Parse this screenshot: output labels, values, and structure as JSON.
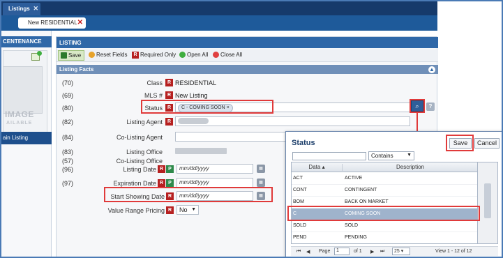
{
  "topbar": {
    "tab": "Listings"
  },
  "subbar": {
    "tab": "New RESIDENTIAL"
  },
  "sidebar": {
    "header": "CENTENANCE",
    "photo_text_1": "IMAGE",
    "photo_text_2": "AILABLE",
    "link": "ain Listing"
  },
  "main": {
    "header": "LISTING",
    "toolbar": {
      "save": "Save",
      "reset": "Reset Fields",
      "required": "Required Only",
      "open_all": "Open All",
      "close_all": "Close All"
    },
    "facts_header": "Listing Facts",
    "rows": [
      {
        "num": "(70)",
        "label": "Class",
        "value": "RESIDENTIAL"
      },
      {
        "num": "(69)",
        "label": "MLS #",
        "value": "New Listing"
      },
      {
        "num": "(80)",
        "label": "Status",
        "value": "C - COMING SOON"
      },
      {
        "num": "(82)",
        "label": "Listing Agent",
        "value": ""
      },
      {
        "num": "(84)",
        "label": "Co-Listing Agent",
        "value": ""
      },
      {
        "num": "(83)",
        "label": "Listing Office",
        "value": ""
      },
      {
        "num": "(57)",
        "label": "Co-Listing Office",
        "value": ""
      },
      {
        "num": "(96)",
        "label": "Listing Date",
        "value": "mm/dd/yyyy"
      },
      {
        "num": "(97)",
        "label": "Expiration Date",
        "value": "mm/dd/yyyy"
      },
      {
        "num": "",
        "label": "Start Showing Date",
        "value": "mm/dd/yyyy"
      },
      {
        "num": "",
        "label": "Value Range Pricing",
        "value": "No"
      }
    ],
    "badge_r": "R",
    "badge_p": "P",
    "help": "?"
  },
  "popup": {
    "title": "Status",
    "save": "Save",
    "cancel": "Cancel",
    "operator": "Contains",
    "columns": {
      "data": "Data",
      "description": "Description"
    },
    "rows": [
      {
        "data": "ACT",
        "description": "ACTIVE"
      },
      {
        "data": "CONT",
        "description": "CONTINGENT"
      },
      {
        "data": "BOM",
        "description": "BACK ON MARKET"
      },
      {
        "data": "C",
        "description": "COMING SOON"
      },
      {
        "data": "SOLD",
        "description": "SOLD"
      },
      {
        "data": "PEND",
        "description": "PENDING"
      }
    ],
    "pager": {
      "page_label": "Page",
      "page": "1",
      "of_label": "of 1",
      "page_size": "25",
      "view": "View 1 - 12 of 12"
    }
  }
}
